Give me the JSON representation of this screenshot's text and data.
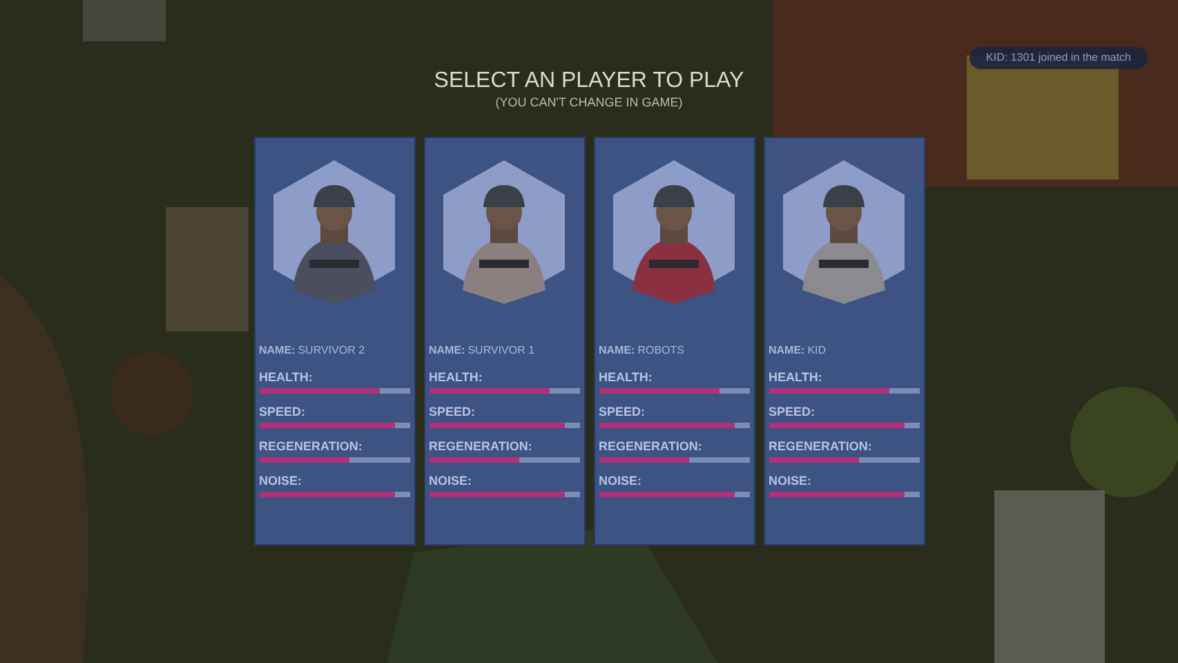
{
  "title": "SELECT AN PLAYER TO PLAY",
  "subtitle": "(YOU CAN'T CHANGE IN GAME)",
  "notification": "KID: 1301 joined in the match",
  "players": [
    {
      "name_label": "NAME:",
      "name": "SURVIVOR 2",
      "stats": [
        {
          "label": "HEALTH:",
          "level": 0.8
        },
        {
          "label": "SPEED:",
          "level": 0.9
        },
        {
          "label": "REGENERATION:",
          "level": 0.6
        },
        {
          "label": "NOISE:",
          "level": 0.9
        }
      ]
    },
    {
      "name_label": "NAME:",
      "name": "SURVIVOR 1",
      "stats": [
        {
          "label": "HEALTH:",
          "level": 0.8
        },
        {
          "label": "SPEED:",
          "level": 0.9
        },
        {
          "label": "REGENERATION:",
          "level": 0.6
        },
        {
          "label": "NOISE:",
          "level": 0.9
        }
      ]
    },
    {
      "name_label": "NAME:",
      "name": "ROBOTS",
      "stats": [
        {
          "label": "HEALTH:",
          "level": 0.8
        },
        {
          "label": "SPEED:",
          "level": 0.9
        },
        {
          "label": "REGENERATION:",
          "level": 0.6
        },
        {
          "label": "NOISE:",
          "level": 0.9
        }
      ]
    },
    {
      "name_label": "NAME:",
      "name": "KID",
      "stats": [
        {
          "label": "HEALTH:",
          "level": 0.8
        },
        {
          "label": "SPEED:",
          "level": 0.9
        },
        {
          "label": "REGENERATION:",
          "level": 0.6
        },
        {
          "label": "NOISE:",
          "level": 0.9
        }
      ]
    }
  ]
}
